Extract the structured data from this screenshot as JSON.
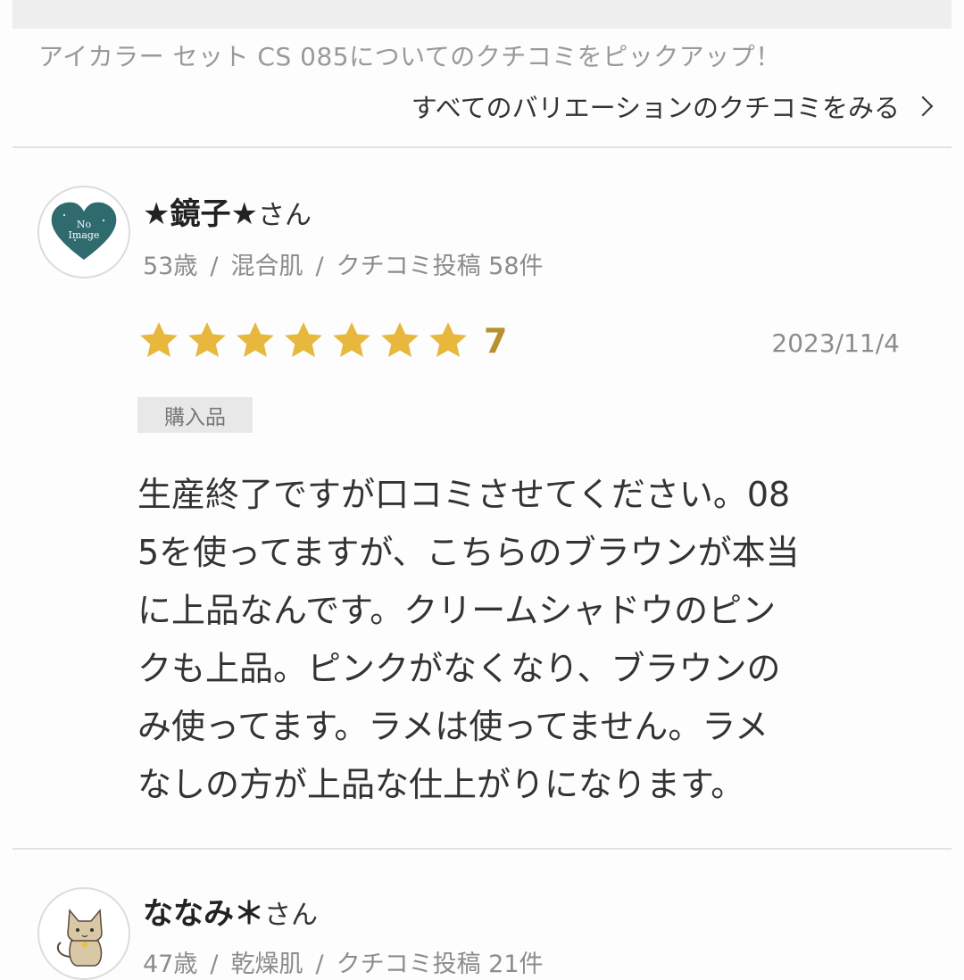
{
  "header": {
    "pickup_text": "アイカラー セット CS 085についてのクチコミをピックアップ！",
    "all_variations_link": "すべてのバリエーションのクチコミをみる"
  },
  "reviews": [
    {
      "name": "★鏡子★",
      "honorific": "さん",
      "age": "53歳",
      "skin": "混合肌",
      "post_count": "クチコミ投稿 58件",
      "avatar_icon": "no-image-heart-icon",
      "avatar_text_1": "No",
      "avatar_text_2": "Image",
      "rating": "7",
      "rating_value": 7,
      "date": "2023/11/4",
      "badge": "購入品",
      "body_lines": [
        "生産終了ですが口コミさせてください。08",
        "5を使ってますが、こちらのブラウンが本当",
        "に上品なんです。クリームシャドウのピン",
        "クも上品。ピンクがなくなり、ブラウンの",
        "み使ってます。ラメは使ってません。ラメ",
        "なしの方が上品な仕上がりになります。"
      ]
    },
    {
      "name": "ななみ＊",
      "honorific": "さん",
      "age": "47歳",
      "skin": "乾燥肌",
      "post_count": "クチコミ投稿 21件",
      "avatar_icon": "cat-avatar-icon"
    }
  ],
  "colors": {
    "star": "#e8b73e",
    "rating_number": "#b8902e",
    "heart": "#2f6a6e"
  }
}
